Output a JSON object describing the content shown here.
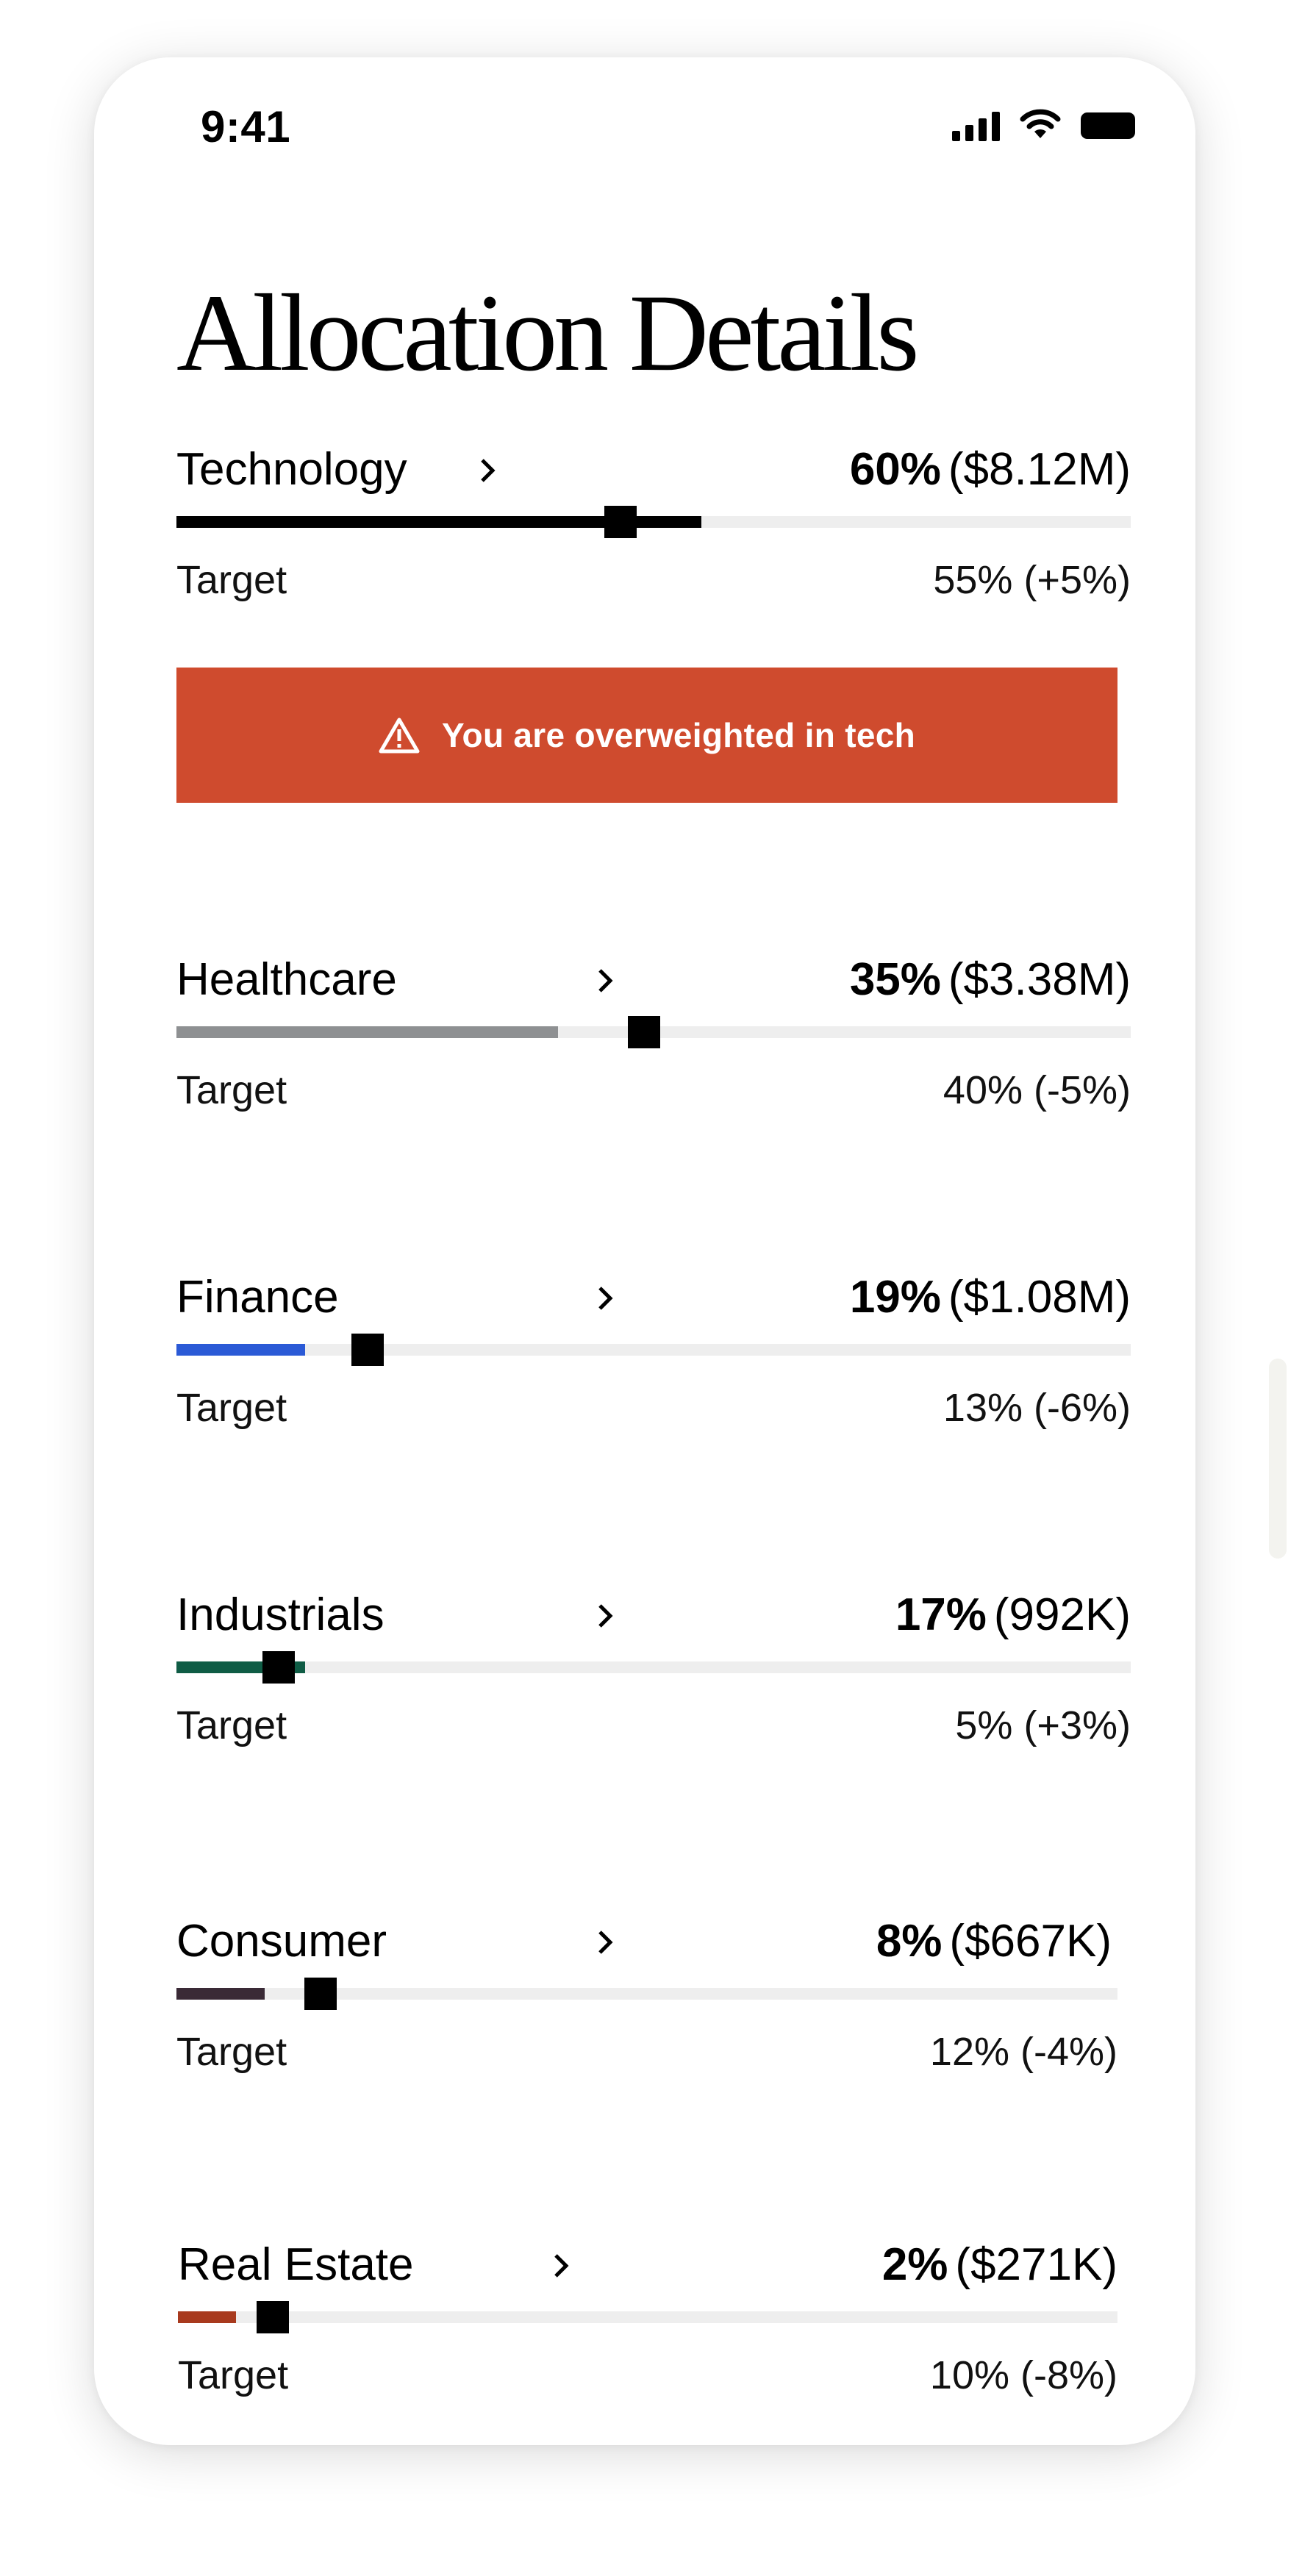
{
  "status": {
    "time": "9:41"
  },
  "page": {
    "title": "Allocation Details"
  },
  "sectors": [
    {
      "name": "Technology",
      "pct": "60%",
      "amount": "($8.12M)",
      "target_label": "Target",
      "target": "55% (+5%)",
      "fill_pct": 55,
      "marker_pct": 46.5,
      "color": "#000000"
    },
    {
      "name": "Healthcare",
      "pct": "35%",
      "amount": "($3.38M)",
      "target_label": "Target",
      "target": "40% (-5%)",
      "fill_pct": 40,
      "marker_pct": 49,
      "color": "#8e9092"
    },
    {
      "name": "Finance",
      "pct": "19%",
      "amount": "($1.08M)",
      "target_label": "Target",
      "target": "13% (-6%)",
      "fill_pct": 13.5,
      "marker_pct": 20,
      "color": "#2b5ad6"
    },
    {
      "name": "Industrials",
      "pct": "17%",
      "amount": "(992K)",
      "target_label": "Target",
      "target": "5% (+3%)",
      "fill_pct": 13.5,
      "marker_pct": 10.7,
      "color": "#0f5c45"
    },
    {
      "name": "Consumer",
      "pct": "8%",
      "amount": "($667K)",
      "target_label": "Target",
      "target": "12% (-4%)",
      "fill_pct": 9.4,
      "marker_pct": 15.3,
      "color": "#3a2a36"
    },
    {
      "name": "Real Estate",
      "pct": "2%",
      "amount": "($271K)",
      "target_label": "Target",
      "target": "10% (-8%)",
      "fill_pct": 6.2,
      "marker_pct": 10.1,
      "color": "#a83a1e"
    }
  ],
  "alert": {
    "text": "You are overweighted in tech",
    "icon": "warning-icon",
    "color": "#cf4b2e"
  }
}
